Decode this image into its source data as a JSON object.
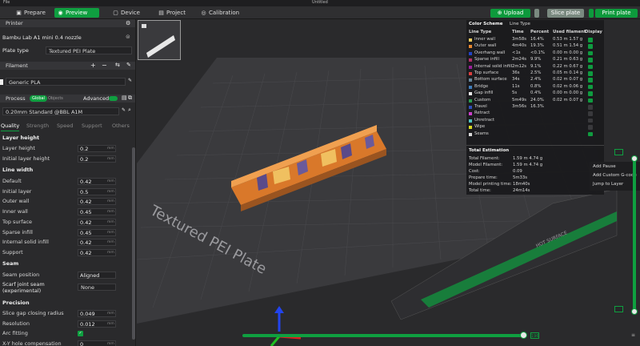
{
  "window": {
    "menu": "File",
    "title": "Untitled"
  },
  "tabs": [
    {
      "label": "Prepare"
    },
    {
      "label": "Preview"
    },
    {
      "label": "Device"
    },
    {
      "label": "Project"
    },
    {
      "label": "Calibration"
    }
  ],
  "toolbar": {
    "upload": "Upload",
    "slice": "Slice plate",
    "print": "Print plate"
  },
  "printer": {
    "section": "Printer",
    "name": "Bambu Lab A1 mini 0.4 nozzle",
    "plate_label": "Plate type",
    "plate_value": "Textured PEI Plate"
  },
  "filament": {
    "section": "Filament",
    "item": "Generic PLA"
  },
  "process": {
    "section": "Process",
    "global": "Global",
    "objects": "Objects",
    "advanced": "Advanced",
    "preset": "0.20mm Standard @BBL A1M",
    "tabs": [
      "Quality",
      "Strength",
      "Speed",
      "Support",
      "Others"
    ]
  },
  "layer_height": {
    "title": "Layer height",
    "rows": [
      {
        "label": "Layer height",
        "value": "0.2",
        "unit": "mm"
      },
      {
        "label": "Initial layer height",
        "value": "0.2",
        "unit": "mm"
      }
    ]
  },
  "line_width": {
    "title": "Line width",
    "rows": [
      {
        "label": "Default",
        "value": "0.42",
        "unit": "mm"
      },
      {
        "label": "Initial layer",
        "value": "0.5",
        "unit": "mm"
      },
      {
        "label": "Outer wall",
        "value": "0.42",
        "unit": "mm"
      },
      {
        "label": "Inner wall",
        "value": "0.45",
        "unit": "mm"
      },
      {
        "label": "Top surface",
        "value": "0.42",
        "unit": "mm"
      },
      {
        "label": "Sparse infill",
        "value": "0.45",
        "unit": "mm"
      },
      {
        "label": "Internal solid infill",
        "value": "0.42",
        "unit": "mm"
      },
      {
        "label": "Support",
        "value": "0.42",
        "unit": "mm"
      }
    ]
  },
  "seam": {
    "title": "Seam",
    "position_label": "Seam position",
    "position_value": "Aligned",
    "scarf_label": "Scarf joint seam (experimental)",
    "scarf_value": "None"
  },
  "precision": {
    "title": "Precision",
    "rows": [
      {
        "label": "Slice gap closing radius",
        "value": "0.049",
        "unit": "mm"
      },
      {
        "label": "Resolution",
        "value": "0.012",
        "unit": "mm"
      },
      {
        "label": "Arc fitting",
        "value": ""
      },
      {
        "label": "X-Y hole compensation",
        "value": "0",
        "unit": "mm"
      }
    ]
  },
  "legend": {
    "color_scheme": "Color Scheme",
    "scheme_value": "Line Type",
    "cols": [
      "Line Type",
      "Time",
      "Percent",
      "Used filament",
      "Display"
    ],
    "rows": [
      {
        "name": "Inner wall",
        "time": "3m58s",
        "percent": "16.4%",
        "used": "0.53 m  1.57 g",
        "color": "#f0d060",
        "display": true
      },
      {
        "name": "Outer wall",
        "time": "4m40s",
        "percent": "19.3%",
        "used": "0.51 m  1.54 g",
        "color": "#f08a30",
        "display": true
      },
      {
        "name": "Overhang wall",
        "time": "<1s",
        "percent": "<0.1%",
        "used": "0.00 m  0.00 g",
        "color": "#2244cc",
        "display": true
      },
      {
        "name": "Sparse infill",
        "time": "2m24s",
        "percent": "9.9%",
        "used": "0.21 m  0.63 g",
        "color": "#b8306a",
        "display": true
      },
      {
        "name": "Internal solid infill",
        "time": "2m12s",
        "percent": "9.1%",
        "used": "0.22 m  0.67 g",
        "color": "#a020a0",
        "display": true
      },
      {
        "name": "Top surface",
        "time": "36s",
        "percent": "2.5%",
        "used": "0.05 m  0.14 g",
        "color": "#e04040",
        "display": true
      },
      {
        "name": "Bottom surface",
        "time": "34s",
        "percent": "2.4%",
        "used": "0.02 m  0.07 g",
        "color": "#6a8aa0",
        "display": true
      },
      {
        "name": "Bridge",
        "time": "11s",
        "percent": "0.8%",
        "used": "0.02 m  0.06 g",
        "color": "#4080c0",
        "display": true
      },
      {
        "name": "Gap infill",
        "time": "5s",
        "percent": "0.4%",
        "used": "0.00 m  0.00 g",
        "color": "#f0f0f0",
        "display": true
      },
      {
        "name": "Custom",
        "time": "5m49s",
        "percent": "24.0%",
        "used": "0.02 m  0.07 g",
        "color": "#2aa050",
        "display": true
      },
      {
        "name": "Travel",
        "time": "3m56s",
        "percent": "16.3%",
        "used": "",
        "color": "#3050c0",
        "display": false
      },
      {
        "name": "Retract",
        "time": "",
        "percent": "",
        "used": "",
        "color": "#d040d0",
        "display": false
      },
      {
        "name": "Unretract",
        "time": "",
        "percent": "",
        "used": "",
        "color": "#50c8c8",
        "display": false
      },
      {
        "name": "Wipe",
        "time": "",
        "percent": "",
        "used": "",
        "color": "#e0e020",
        "display": false
      },
      {
        "name": "Seams",
        "time": "",
        "percent": "",
        "used": "",
        "color": "#e0e0e0",
        "display": true
      }
    ],
    "estimation_title": "Total Estimation",
    "estimation": [
      {
        "label": "Total Filament:",
        "value": "1.59 m    4.74 g"
      },
      {
        "label": "Model Filament:",
        "value": "1.59 m    4.74 g"
      },
      {
        "label": "Cost:",
        "value": "0.09"
      },
      {
        "label": "Prepare time:",
        "value": "5m33s"
      },
      {
        "label": "Model printing time:",
        "value": "18m40s"
      },
      {
        "label": "Total time:",
        "value": "24m14s"
      }
    ]
  },
  "context_menu": [
    "Add Pause",
    "Add Custom G-code",
    "Jump to Layer"
  ],
  "plate": {
    "text": "Textured PEI Plate",
    "bed_badge": "HOT SURFACE"
  },
  "layer_labels": {
    "top": "",
    "bottom": "",
    "h_end": "196"
  },
  "colors": {
    "accent": "#0f9f40",
    "model": "#d9782a"
  }
}
